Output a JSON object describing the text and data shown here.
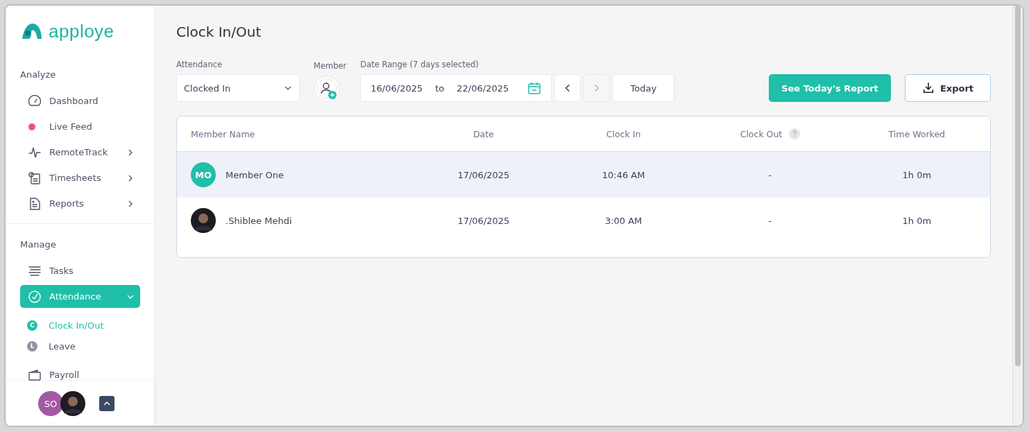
{
  "brand": {
    "name": "apploye"
  },
  "sidebar": {
    "sections": [
      {
        "title": "Analyze",
        "items": [
          {
            "label": "Dashboard",
            "kind": "link",
            "selected": false
          },
          {
            "label": "Live Feed",
            "kind": "dot",
            "color": "#f2536b",
            "selected": false
          },
          {
            "label": "RemoteTrack",
            "kind": "expandable",
            "expanded": false,
            "selected": false
          },
          {
            "label": "Timesheets",
            "kind": "expandable",
            "expanded": false,
            "selected": false
          },
          {
            "label": "Reports",
            "kind": "expandable",
            "expanded": false,
            "selected": false
          }
        ]
      },
      {
        "title": "Manage",
        "items": [
          {
            "label": "Tasks",
            "kind": "link",
            "selected": false
          },
          {
            "label": "Attendance",
            "kind": "expandable",
            "expanded": true,
            "selected": true,
            "children": [
              {
                "badge": "C",
                "label": "Clock In/Out",
                "selected": true
              },
              {
                "badge": "L",
                "label": "Leave",
                "selected": false
              }
            ]
          },
          {
            "label": "Payroll",
            "kind": "link",
            "selected": false
          }
        ]
      }
    ],
    "footer": {
      "initials": "SO"
    }
  },
  "page": {
    "title": "Clock In/Out"
  },
  "filters": {
    "attendance": {
      "label": "Attendance",
      "value": "Clocked In"
    },
    "member": {
      "label": "Member"
    },
    "date_range": {
      "label": "Date Range (7 days selected)",
      "start": "16/06/2025",
      "separator": "to",
      "end": "22/06/2025",
      "prev_disabled": false,
      "next_disabled": true,
      "today": "Today"
    }
  },
  "actions": {
    "report": "See Today's Report",
    "export": "Export"
  },
  "table": {
    "columns": [
      "Member Name",
      "Date",
      "Clock In",
      "Clock Out",
      "Time Worked"
    ],
    "rows": [
      {
        "kind": "initials",
        "initials": "MO",
        "name": "Member One",
        "date": "17/06/2025",
        "clock_in": "10:46 AM",
        "clock_out": "-",
        "time_worked": "1h 0m",
        "highlighted": true
      },
      {
        "name": ".Shiblee Mehdi",
        "date": "17/06/2025",
        "clock_in": "3:00 AM",
        "clock_out": "-",
        "time_worked": "1h 0m",
        "highlighted": false
      }
    ]
  }
}
